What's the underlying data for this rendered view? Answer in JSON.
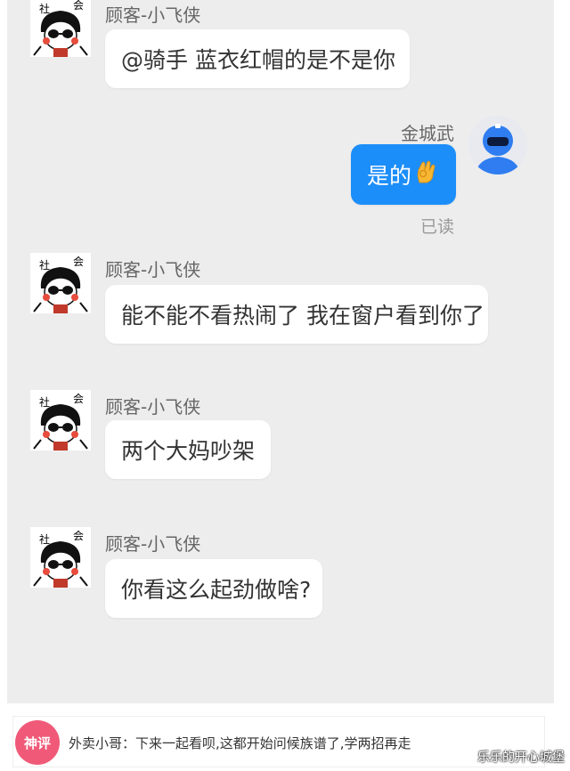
{
  "messages": [
    {
      "sender": "顾客-小飞侠",
      "text": "@骑手  蓝衣红帽的是不是你",
      "side": "left"
    },
    {
      "sender": "金城武",
      "text": "是的",
      "emoji": "ok-hand",
      "status": "已读",
      "side": "right"
    },
    {
      "sender": "顾客-小飞侠",
      "text": "能不能不看热闹了 我在窗户看到你了",
      "side": "left"
    },
    {
      "sender": "顾客-小飞侠",
      "text": "两个大妈吵架",
      "side": "left"
    },
    {
      "sender": "顾客-小飞侠",
      "text": "你看这么起劲做啥?",
      "side": "left"
    }
  ],
  "avatar_caption": {
    "left": "社",
    "right": "会"
  },
  "comment": {
    "badge": "神评",
    "text": "外卖小哥：下来一起看呗,这都开始问候族谱了,学两招再走"
  },
  "watermark": "乐乐的开心城堡",
  "colors": {
    "chat_background": "#ededed",
    "my_bubble": "#1c8ef9",
    "badge": "#f05a78"
  }
}
